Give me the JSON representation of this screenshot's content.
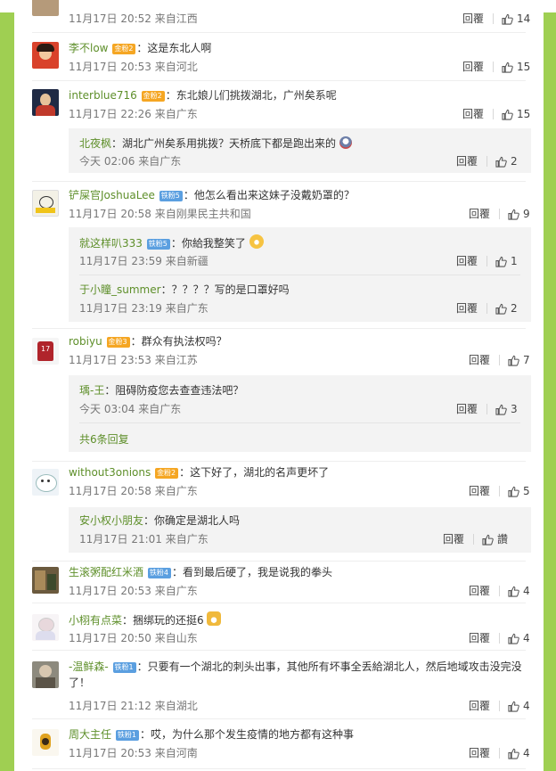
{
  "ui": {
    "reply": "回覆",
    "from_prefix": "来自"
  },
  "colors": {
    "page_bg": "#9fcf52",
    "username": "#5e8f2a",
    "badge_gold": "#f5a623",
    "badge_blue": "#5b9fe0"
  },
  "comments": [
    {
      "time": "11月17日 20:52 来自江西",
      "likes": "14"
    },
    {
      "username": "李不low",
      "badge": "金粉2",
      "text": "：这是东北人啊",
      "time": "11月17日 20:53 来自河北",
      "likes": "15"
    },
    {
      "username": "interblue716",
      "badge": "金粉2",
      "text": "：东北娘儿们挑拨湖北，广州矣系呢",
      "time": "11月17日 22:26 来自广东",
      "likes": "15",
      "replies": [
        {
          "username": "北夜枫",
          "text": "：湖北广州矣系用挑拨？天桥底下都是跑出来的",
          "time": "今天 02:06 来自广东",
          "likes": "2"
        }
      ]
    },
    {
      "username": "铲屎官JoshuaLee",
      "badge": "铁粉5",
      "text": "：他怎么看出来这妹子没戴奶罩的？",
      "time": "11月17日 20:58 来自刚果民主共和国",
      "likes": "9",
      "replies": [
        {
          "username": "就这样叭333",
          "badge": "铁粉5",
          "text": "：你給我整笑了",
          "time": "11月17日 23:59 来自新疆",
          "likes": "1"
        },
        {
          "username": "于小瞳_summer",
          "text": "：？？？？写的是口罩好吗",
          "time": "11月17日 23:19 来自广东",
          "likes": "2"
        }
      ]
    },
    {
      "username": "robiyu",
      "badge": "金粉3",
      "text": "：群众有执法权吗？",
      "time": "11月17日 23:53 来自江苏",
      "likes": "7",
      "replies": [
        {
          "username": "瑀-王",
          "text": "：阻碍防疫您去查查违法吧？",
          "time": "今天 03:04 来自广东",
          "likes": "3"
        }
      ],
      "more": "共6条回复"
    },
    {
      "username": "without3onions",
      "badge": "金粉2",
      "text": "：这下好了，湖北的名声更坏了",
      "time": "11月17日 20:58 来自广东",
      "likes": "5",
      "replies": [
        {
          "username": "安小权小朋友",
          "text": "：你确定是湖北人吗",
          "time": "11月17日 21:01 来自广东",
          "likes": "讚"
        }
      ]
    },
    {
      "username": "生滚粥配红米酒",
      "badge": "铁粉4",
      "text": "：看到最后硬了，我是说我的拳头",
      "time": "11月17日 20:53 来自广东",
      "likes": "4"
    },
    {
      "username": "小栩有点菜",
      "text": "：捆绑玩的还挺6",
      "time": "11月17日 20:50 来自山东",
      "likes": "4"
    },
    {
      "username": "-温鲜森-",
      "badge": "铁粉1",
      "text": "：只要有一个湖北的刺头出事，其他所有坏事全丢給湖北人，然后地域攻击没完没了！",
      "time": "11月17日 21:12 来自湖北",
      "likes": "4"
    },
    {
      "username": "周大主任",
      "badge": "铁粉1",
      "text": "：哎，为什么那个发生疫情的地方都有这种事",
      "time": "11月17日 20:53 来自河南",
      "likes": "4"
    }
  ]
}
